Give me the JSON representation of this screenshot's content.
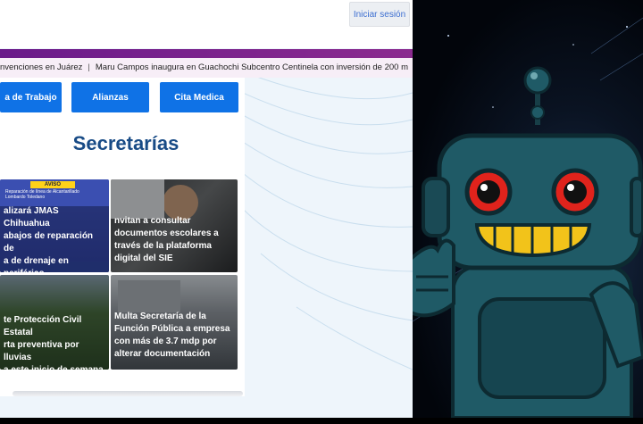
{
  "header": {
    "login_label": "Iniciar sesión"
  },
  "ticker": {
    "items": [
      "nvenciones en Juárez",
      "Maru Campos inaugura en Guachochi Subcentro Centinela con inversión de 200 m"
    ],
    "separator": "|"
  },
  "quick_links": [
    {
      "label": "a de Trabajo"
    },
    {
      "label": "Alianzas"
    },
    {
      "label": "Cita Medica"
    }
  ],
  "section": {
    "title": "Secretarías"
  },
  "news": [
    {
      "headline": "alizará JMAS Chihuahua\nabajos de reparación de\na de drenaje en periférico\nombardo Toledano este\nércoles",
      "aviso_tag": "AVISO",
      "aviso_text": "Reparación de línea de Alcantarillado\nLombardo Toledano"
    },
    {
      "headline": "nvitan a consultar\ndocumentos escolares a\ntravés de la plataforma\ndigital del SIE"
    },
    {
      "headline": "te Protección Civil Estatal\nrta preventiva por lluvias\na este inicio de semana"
    },
    {
      "headline": "Multa Secretaría de la\nFunción Pública a empresa\ncon más de 3.7 mdp por\nalterar documentación"
    }
  ],
  "colors": {
    "primary_blue": "#0f72e6",
    "title_blue": "#184b86",
    "purple_bar": "#6a1a8a",
    "robot_teal": "#1f5a66",
    "robot_eye_red": "#e0231c",
    "robot_mouth_yellow": "#f2c31a"
  }
}
